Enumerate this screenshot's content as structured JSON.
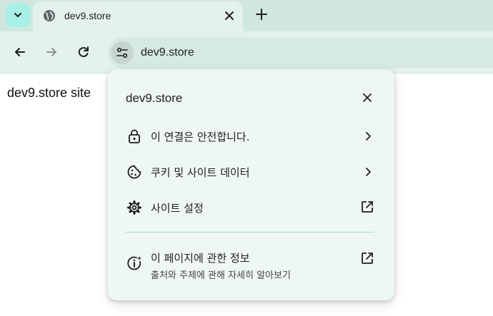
{
  "browser": {
    "tab": {
      "title": "dev9.store",
      "favicon": "globe-icon"
    },
    "tab_search_icon": "chevron-down-icon",
    "new_tab_icon": "plus-icon",
    "nav": {
      "back": "arrow-left-icon",
      "forward": "arrow-right-icon",
      "reload": "reload-icon"
    },
    "omnibox": {
      "url": "dev9.store",
      "site_info_icon": "tune-icon"
    }
  },
  "page": {
    "text": "dev9.store site"
  },
  "popup": {
    "title": "dev9.store",
    "items": [
      {
        "label": "이 연결은 안전합니다.",
        "icon": "lock-icon",
        "trailing": "chevron-right-icon"
      },
      {
        "label": "쿠키 및 사이트 데이터",
        "icon": "cookie-icon",
        "trailing": "chevron-right-icon"
      },
      {
        "label": "사이트 설정",
        "icon": "gear-icon",
        "trailing": "external-link-icon"
      }
    ],
    "about": {
      "label": "이 페이지에 관한 정보",
      "sublabel": "출처와 주제에 관해 자세히 알아보기",
      "icon": "info-sparkle-icon",
      "trailing": "external-link-icon"
    }
  },
  "colors": {
    "tabstrip": "#cfe7df",
    "toolbar": "#e4f2ed",
    "popup_bg": "#eff7f4",
    "accent": "#a8f0e6",
    "divider": "#9fdbd5"
  }
}
